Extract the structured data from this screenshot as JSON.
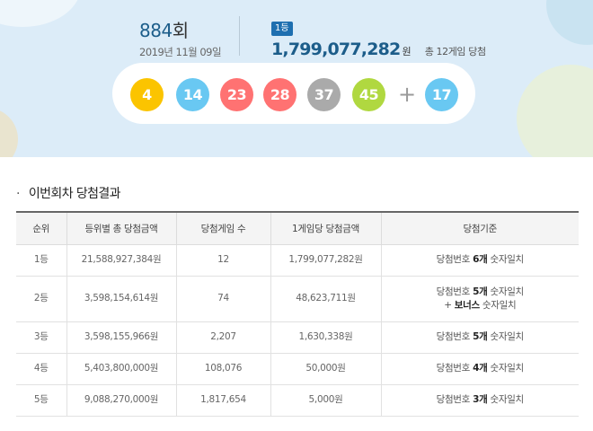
{
  "draw": {
    "number": "884",
    "suffix": "회",
    "date": "2019년 11월 09일"
  },
  "first_prize": {
    "badge": "1등",
    "amount": "1,799,077,282",
    "unit": "원",
    "winners": "총 12게임 당첨"
  },
  "balls": [
    {
      "number": "4",
      "color": "#fbc400"
    },
    {
      "number": "14",
      "color": "#69c8f2"
    },
    {
      "number": "23",
      "color": "#ff7272"
    },
    {
      "number": "28",
      "color": "#ff7272"
    },
    {
      "number": "37",
      "color": "#aaaaaa"
    },
    {
      "number": "45",
      "color": "#b0d840"
    }
  ],
  "plus_sign": "+",
  "bonus_ball": {
    "number": "17",
    "color": "#69c8f2"
  },
  "section": {
    "bullet": "·",
    "title": "이번회차 당첨결과"
  },
  "table": {
    "headers": [
      "순위",
      "등위별 총 당첨금액",
      "당첨게임 수",
      "1게임당 당첨금액",
      "당첨기준"
    ],
    "rows": [
      {
        "rank": "1등",
        "total": "21,588,927,384원",
        "games": "12",
        "per_game": "1,799,077,282원",
        "crit_pre": "당첨번호 ",
        "crit_bold": "6개",
        "crit_post": " 숫자일치",
        "crit_line2": ""
      },
      {
        "rank": "2등",
        "total": "3,598,154,614원",
        "games": "74",
        "per_game": "48,623,711원",
        "crit_pre": "당첨번호 ",
        "crit_bold": "5개",
        "crit_post": " 숫자일치",
        "crit_line2_pre": "+ ",
        "crit_line2_bold": "보너스",
        "crit_line2_post": " 숫자일치"
      },
      {
        "rank": "3등",
        "total": "3,598,155,966원",
        "games": "2,207",
        "per_game": "1,630,338원",
        "crit_pre": "당첨번호 ",
        "crit_bold": "5개",
        "crit_post": " 숫자일치"
      },
      {
        "rank": "4등",
        "total": "5,403,800,000원",
        "games": "108,076",
        "per_game": "50,000원",
        "crit_pre": "당첨번호 ",
        "crit_bold": "4개",
        "crit_post": " 숫자일치"
      },
      {
        "rank": "5등",
        "total": "9,088,270,000원",
        "games": "1,817,654",
        "per_game": "5,000원",
        "crit_pre": "당첨번호 ",
        "crit_bold": "3개",
        "crit_post": " 숫자일치"
      }
    ]
  }
}
